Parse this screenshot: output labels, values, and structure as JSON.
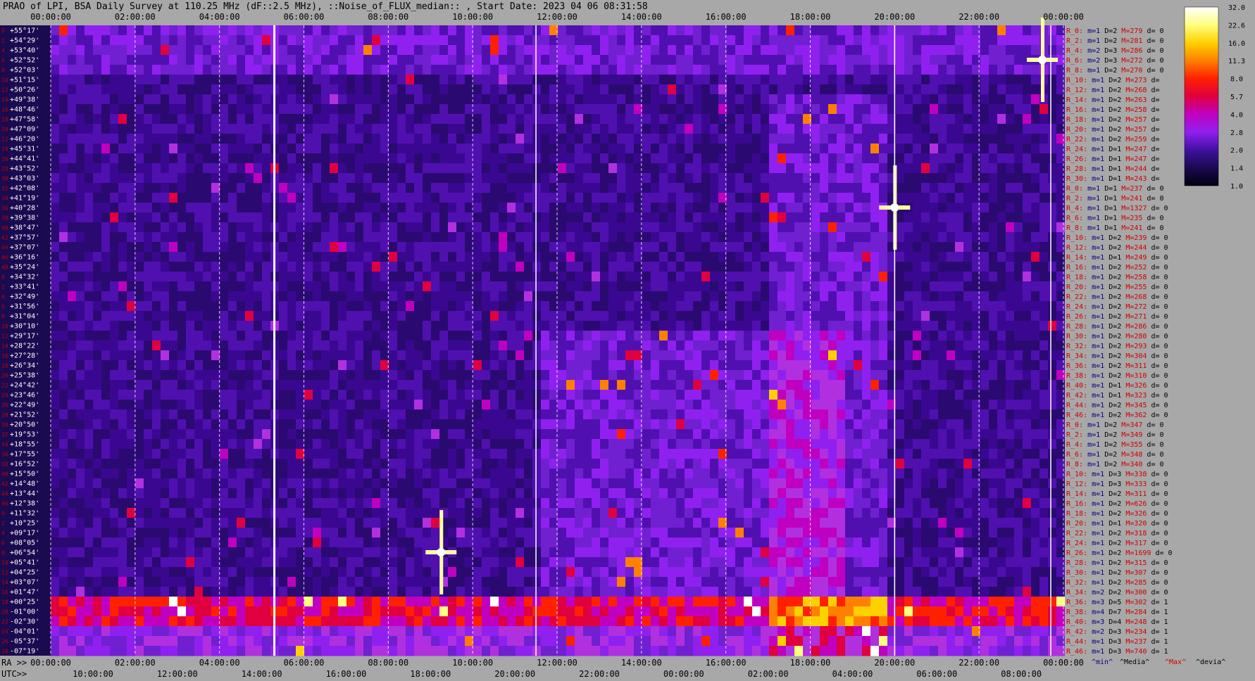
{
  "title": "PRAO of LPI, BSA Daily Survey at 110.25 MHz (dF::2.5 MHz), ::Noise_of_FLUX_median:: , Start Date: 2023 04 06 08:31:58",
  "axes": {
    "top_ticks": [
      "00:00:00",
      "02:00:00",
      "04:00:00",
      "06:00:00",
      "08:00:00",
      "10:00:00",
      "12:00:00",
      "14:00:00",
      "16:00:00",
      "18:00:00",
      "20:00:00",
      "22:00:00",
      "00:00:00"
    ],
    "ra_prefix": "RA >>",
    "ra_ticks": [
      "00:00:00",
      "02:00:00",
      "04:00:00",
      "06:00:00",
      "08:00:00",
      "10:00:00",
      "12:00:00",
      "14:00:00",
      "16:00:00",
      "18:00:00",
      "20:00:00",
      "22:00:00",
      "00:00:00"
    ],
    "utc_prefix": "UTC>>",
    "utc_ticks": [
      "10:00:00",
      "12:00:00",
      "14:00:00",
      "16:00:00",
      "18:00:00",
      "20:00:00",
      "22:00:00",
      "00:00:00",
      "02:00:00",
      "04:00:00",
      "06:00:00",
      "08:00:00"
    ]
  },
  "colorbar": {
    "ticks": [
      "32.0",
      "22.6",
      "16.0",
      "11.3",
      "8.0",
      "5.7",
      "4.0",
      "2.8",
      "2.0",
      "1.4",
      "1.0"
    ],
    "colors": [
      "#ffffff",
      "#ffff80",
      "#ffd000",
      "#ff8000",
      "#ff2000",
      "#e00040",
      "#c000c0",
      "#9020f0",
      "#4010a0",
      "#1a0a50",
      "#000010"
    ]
  },
  "legend": {
    "min": "^min^",
    "median": "^Media^",
    "max": "^Max^",
    "dev": "^devia^"
  },
  "chart_data": {
    "type": "heatmap",
    "title": "PRAO of LPI, BSA Daily Survey at 110.25 MHz (dF::2.5 MHz), ::Noise_of_FLUX_median:: , Start Date: 2023 04 06 08:31:58",
    "x_range_ra": [
      "00:00:00",
      "24:00:00"
    ],
    "declinations": [
      "+55°17'",
      "+54°29'",
      "+53°40'",
      "+52°52'",
      "+52°03'",
      "+51°15'",
      "+50°26'",
      "+49°38'",
      "+48°46'",
      "+47°58'",
      "+47°09'",
      "+46°20'",
      "+45°31'",
      "+44°41'",
      "+43°52'",
      "+43°03'",
      "+42°08'",
      "+41°19'",
      "+40°28'",
      "+39°38'",
      "+38°47'",
      "+37°57'",
      "+37°07'",
      "+36°16'",
      "+35°24'",
      "+34°32'",
      "+33°41'",
      "+32°49'",
      "+31°56'",
      "+31°04'",
      "+30°10'",
      "+29°17'",
      "+28°22'",
      "+27°28'",
      "+26°34'",
      "+25°38'",
      "+24°42'",
      "+23°46'",
      "+22°49'",
      "+21°52'",
      "+20°50'",
      "+19°53'",
      "+18°55'",
      "+17°55'",
      "+16°52'",
      "+15°50'",
      "+14°48'",
      "+13°44'",
      "+12°38'",
      "+11°32'",
      "+10°25'",
      "+09°17'",
      "+08°05'",
      "+06°54'",
      "+05°41'",
      "+04°25'",
      "+03°07'",
      "+01°47'",
      "+00°25'",
      "-01°00'",
      "-02°30'",
      "-04°01'",
      "-05°37'",
      "-07°19'"
    ],
    "row_index": [
      "0",
      "2",
      "4",
      "6",
      "8",
      "10",
      "12",
      "14",
      "16",
      "18",
      "20",
      "22",
      "24",
      "26",
      "28",
      "30",
      "32",
      "34",
      "36",
      "38",
      "40",
      "42",
      "44",
      "46",
      "48",
      "0",
      "2",
      "4",
      "6",
      "8",
      "10",
      "12",
      "14",
      "16",
      "18",
      "20",
      "22",
      "24",
      "26",
      "28",
      "30",
      "32",
      "34",
      "36",
      "38",
      "40",
      "42",
      "44",
      "46",
      "0",
      "2",
      "4",
      "6",
      "8",
      "10",
      "12",
      "14",
      "16",
      "18",
      "20",
      "22",
      "24",
      "26",
      "28"
    ],
    "colorscale": [
      1.0,
      1.4,
      2.0,
      2.8,
      4.0,
      5.7,
      8.0,
      11.3,
      16.0,
      22.6,
      32.0
    ],
    "bright_sources": [
      {
        "ra": "09:15",
        "dec_row": 53,
        "value": 32
      },
      {
        "ra": "20:00",
        "dec_row": 18,
        "value": 32
      },
      {
        "ra": "23:30",
        "dec_row": 3,
        "value": 32
      }
    ],
    "row_stats": [
      {
        "label": "R_0:",
        "m": "1",
        "D": "2",
        "M": "279",
        "d": "0"
      },
      {
        "label": "R_2:",
        "m": "1",
        "D": "2",
        "M": "281",
        "d": "0"
      },
      {
        "label": "R_4:",
        "m": "2",
        "D": "3",
        "M": "286",
        "d": "0"
      },
      {
        "label": "R_6:",
        "m": "2",
        "D": "3",
        "M": "272",
        "d": "0"
      },
      {
        "label": "R_8:",
        "m": "1",
        "D": "2",
        "M": "270",
        "d": "0"
      },
      {
        "label": "R_10:",
        "m": "1",
        "D": "2",
        "M": "273",
        "d": ""
      },
      {
        "label": "R_12:",
        "m": "1",
        "D": "2",
        "M": "268",
        "d": ""
      },
      {
        "label": "R_14:",
        "m": "1",
        "D": "2",
        "M": "263",
        "d": ""
      },
      {
        "label": "R_16:",
        "m": "1",
        "D": "2",
        "M": "258",
        "d": ""
      },
      {
        "label": "R_18:",
        "m": "1",
        "D": "2",
        "M": "257",
        "d": ""
      },
      {
        "label": "R_20:",
        "m": "1",
        "D": "2",
        "M": "257",
        "d": ""
      },
      {
        "label": "R_22:",
        "m": "1",
        "D": "2",
        "M": "259",
        "d": ""
      },
      {
        "label": "R_24:",
        "m": "1",
        "D": "1",
        "M": "247",
        "d": ""
      },
      {
        "label": "R_26:",
        "m": "1",
        "D": "1",
        "M": "247",
        "d": ""
      },
      {
        "label": "R_28:",
        "m": "1",
        "D": "1",
        "M": "244",
        "d": ""
      },
      {
        "label": "R_30:",
        "m": "1",
        "D": "1",
        "M": "243",
        "d": ""
      },
      {
        "label": "R_0:",
        "m": "1",
        "D": "1",
        "M": "237",
        "d": "0"
      },
      {
        "label": "R_2:",
        "m": "1",
        "D": "1",
        "M": "241",
        "d": "0"
      },
      {
        "label": "R_4:",
        "m": "1",
        "D": "1",
        "M": "1327",
        "d": "0"
      },
      {
        "label": "R_6:",
        "m": "1",
        "D": "1",
        "M": "235",
        "d": "0"
      },
      {
        "label": "R_8:",
        "m": "1",
        "D": "1",
        "M": "241",
        "d": "0"
      },
      {
        "label": "R_10:",
        "m": "1",
        "D": "2",
        "M": "239",
        "d": "0"
      },
      {
        "label": "R_12:",
        "m": "1",
        "D": "2",
        "M": "244",
        "d": "0"
      },
      {
        "label": "R_14:",
        "m": "1",
        "D": "1",
        "M": "249",
        "d": "0"
      },
      {
        "label": "R_16:",
        "m": "1",
        "D": "2",
        "M": "252",
        "d": "0"
      },
      {
        "label": "R_18:",
        "m": "1",
        "D": "2",
        "M": "258",
        "d": "0"
      },
      {
        "label": "R_20:",
        "m": "1",
        "D": "2",
        "M": "255",
        "d": "0"
      },
      {
        "label": "R_22:",
        "m": "1",
        "D": "2",
        "M": "268",
        "d": "0"
      },
      {
        "label": "R_24:",
        "m": "1",
        "D": "2",
        "M": "272",
        "d": "0"
      },
      {
        "label": "R_26:",
        "m": "1",
        "D": "2",
        "M": "271",
        "d": "0"
      },
      {
        "label": "R_28:",
        "m": "1",
        "D": "2",
        "M": "286",
        "d": "0"
      },
      {
        "label": "R_30:",
        "m": "1",
        "D": "2",
        "M": "280",
        "d": "0"
      },
      {
        "label": "R_32:",
        "m": "1",
        "D": "2",
        "M": "293",
        "d": "0"
      },
      {
        "label": "R_34:",
        "m": "1",
        "D": "2",
        "M": "304",
        "d": "0"
      },
      {
        "label": "R_36:",
        "m": "1",
        "D": "2",
        "M": "311",
        "d": "0"
      },
      {
        "label": "R_38:",
        "m": "1",
        "D": "2",
        "M": "310",
        "d": "0"
      },
      {
        "label": "R_40:",
        "m": "1",
        "D": "1",
        "M": "326",
        "d": "0"
      },
      {
        "label": "R_42:",
        "m": "1",
        "D": "1",
        "M": "323",
        "d": "0"
      },
      {
        "label": "R_44:",
        "m": "1",
        "D": "2",
        "M": "345",
        "d": "0"
      },
      {
        "label": "R_46:",
        "m": "1",
        "D": "2",
        "M": "362",
        "d": "0"
      },
      {
        "label": "R_0:",
        "m": "1",
        "D": "2",
        "M": "347",
        "d": "0"
      },
      {
        "label": "R_2:",
        "m": "1",
        "D": "2",
        "M": "349",
        "d": "0"
      },
      {
        "label": "R_4:",
        "m": "1",
        "D": "2",
        "M": "355",
        "d": "0"
      },
      {
        "label": "R_6:",
        "m": "1",
        "D": "2",
        "M": "348",
        "d": "0"
      },
      {
        "label": "R_8:",
        "m": "1",
        "D": "2",
        "M": "340",
        "d": "0"
      },
      {
        "label": "R_10:",
        "m": "1",
        "D": "3",
        "M": "338",
        "d": "0"
      },
      {
        "label": "R_12:",
        "m": "1",
        "D": "3",
        "M": "333",
        "d": "0"
      },
      {
        "label": "R_14:",
        "m": "1",
        "D": "2",
        "M": "311",
        "d": "0"
      },
      {
        "label": "R_16:",
        "m": "1",
        "D": "2",
        "M": "626",
        "d": "0"
      },
      {
        "label": "R_18:",
        "m": "1",
        "D": "2",
        "M": "326",
        "d": "0"
      },
      {
        "label": "R_20:",
        "m": "1",
        "D": "1",
        "M": "320",
        "d": "0"
      },
      {
        "label": "R_22:",
        "m": "1",
        "D": "2",
        "M": "318",
        "d": "0"
      },
      {
        "label": "R_24:",
        "m": "1",
        "D": "2",
        "M": "317",
        "d": "0"
      },
      {
        "label": "R_26:",
        "m": "1",
        "D": "2",
        "M": "1699",
        "d": "0"
      },
      {
        "label": "R_28:",
        "m": "1",
        "D": "2",
        "M": "315",
        "d": "0"
      },
      {
        "label": "R_30:",
        "m": "1",
        "D": "2",
        "M": "307",
        "d": "0"
      },
      {
        "label": "R_32:",
        "m": "1",
        "D": "2",
        "M": "285",
        "d": "0"
      },
      {
        "label": "R_34:",
        "m": "2",
        "D": "2",
        "M": "300",
        "d": "0"
      },
      {
        "label": "R_36:",
        "m": "3",
        "D": "5",
        "M": "302",
        "d": "1"
      },
      {
        "label": "R_38:",
        "m": "4",
        "D": "7",
        "M": "284",
        "d": "1"
      },
      {
        "label": "R_40:",
        "m": "3",
        "D": "4",
        "M": "248",
        "d": "1"
      },
      {
        "label": "R_42:",
        "m": "2",
        "D": "3",
        "M": "234",
        "d": "1"
      },
      {
        "label": "R_44:",
        "m": "1",
        "D": "3",
        "M": "237",
        "d": "1"
      },
      {
        "label": "R_46:",
        "m": "1",
        "D": "3",
        "M": "740",
        "d": "1"
      }
    ]
  }
}
